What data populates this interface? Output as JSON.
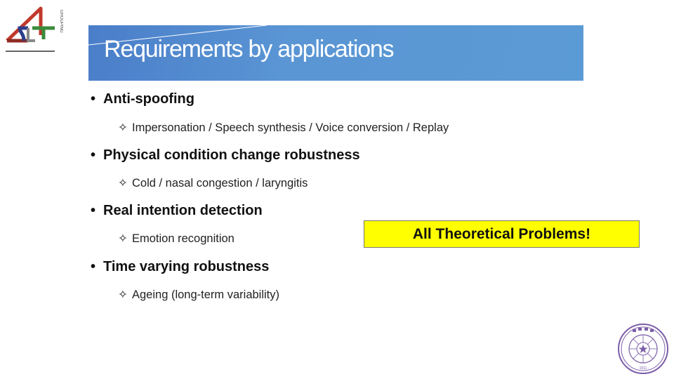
{
  "logo": {
    "letters": "ST",
    "side_text": "GROUPING"
  },
  "slide": {
    "title": "Requirements by applications",
    "bullets": [
      {
        "label": "Anti-spoofing",
        "sub": "Impersonation / Speech synthesis /  Voice conversion / Replay"
      },
      {
        "label": "Physical condition change robustness",
        "sub": "Cold / nasal congestion / laryngitis"
      },
      {
        "label": "Real intention detection",
        "sub": "Emotion recognition"
      },
      {
        "label": "Time varying robustness",
        "sub": "Ageing (long-term variability)"
      }
    ],
    "bullet_glyph": "•",
    "sub_glyph": "✧",
    "callout": "All Theoretical Problems!",
    "seal_year": "· 1911 ·"
  },
  "colors": {
    "banner": "#5b9bd5",
    "callout_bg": "#ffff00",
    "seal": "#7b5ea7"
  }
}
